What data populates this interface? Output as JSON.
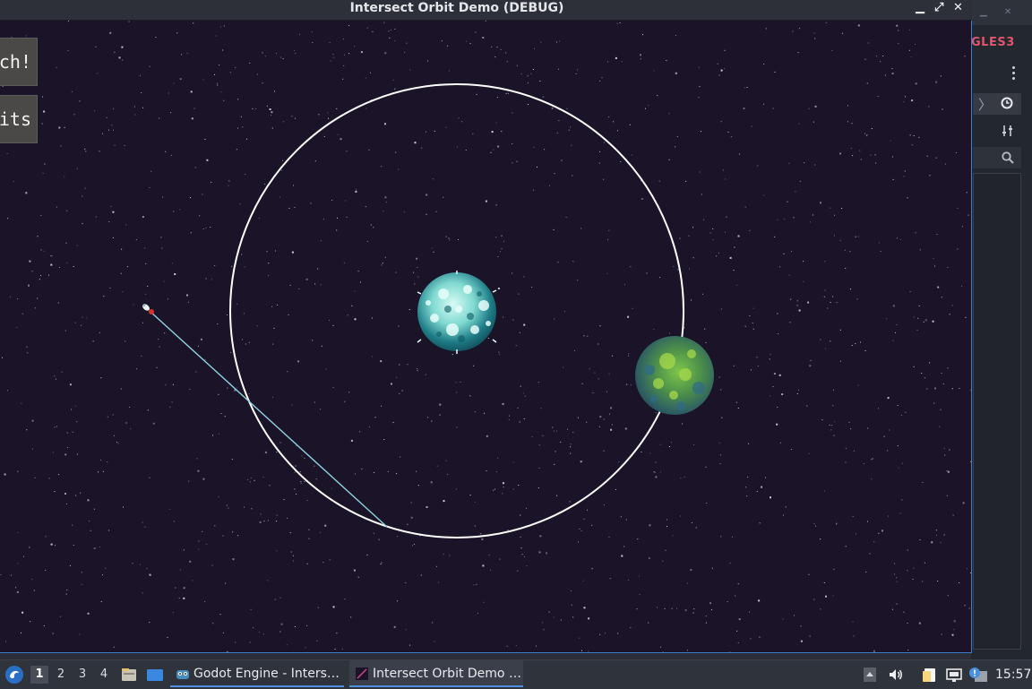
{
  "window": {
    "title": "Intersect Orbit Demo (DEBUG)",
    "buttons": {
      "minimize": "▁",
      "maximize": "⤢",
      "close": "✕"
    }
  },
  "game": {
    "buttons": [
      {
        "label": "nch!"
      },
      {
        "label": "dits"
      }
    ]
  },
  "editor": {
    "renderer_label": "GLES3",
    "chevron": "〉"
  },
  "taskbar": {
    "workspaces": [
      "1",
      "2",
      "3",
      "4"
    ],
    "active_workspace": "1",
    "tasks": [
      {
        "label": "Godot Engine - Inters…",
        "icon": "godot-icon"
      },
      {
        "label": "Intersect Orbit Demo …",
        "icon": "game-window-icon"
      }
    ],
    "clock": "15:57"
  },
  "colors": {
    "space": "#1b1428",
    "orbit": "#ffffff",
    "trajectory": "#8fd3e2",
    "accent": "#4f8ee0",
    "gles": "#e0556f"
  }
}
